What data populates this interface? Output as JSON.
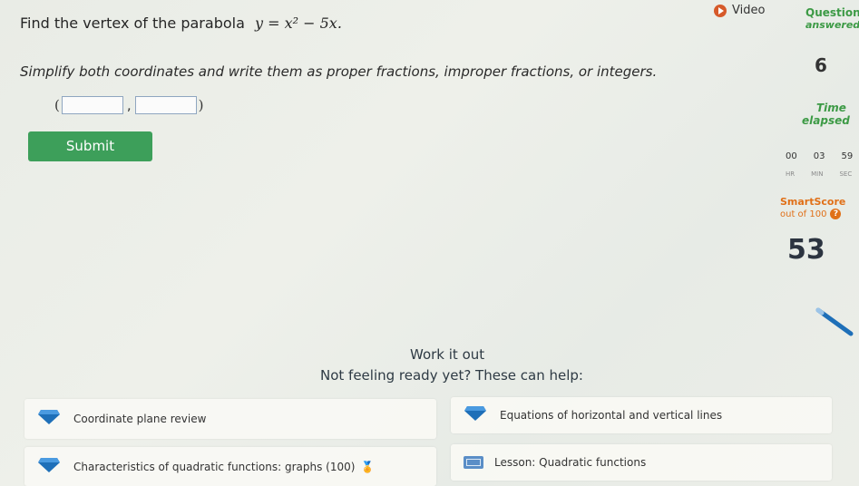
{
  "question": {
    "text": "Find the vertex of the parabola",
    "expression": "y = x² − 5x."
  },
  "instruction": "Simplify both coordinates and write them as proper fractions, improper fractions, or integers.",
  "answer": {
    "open_paren": "(",
    "comma": ",",
    "close_paren": ")",
    "x_value": "",
    "y_value": ""
  },
  "submit_label": "Submit",
  "sidebar": {
    "video_label": "Video",
    "questions_label": "Questions",
    "answered_label": "answered",
    "questions_count": "6",
    "time_label": "Time",
    "elapsed_label": "elapsed",
    "timer": {
      "hr": "00",
      "min": "03",
      "sec": "59"
    },
    "timer_units": {
      "hr": "HR",
      "min": "MIN",
      "sec": "SEC"
    },
    "smartscore_label": "SmartScore",
    "smartscore_sub": "out of 100",
    "smartscore_value": "53"
  },
  "work": {
    "title": "Work it out",
    "subtitle": "Not feeling ready yet? These can help:",
    "items": [
      {
        "label": "Coordinate plane review",
        "icon": "gem-icon"
      },
      {
        "label": "Equations of horizontal and vertical lines",
        "icon": "gem-icon"
      },
      {
        "label": "Characteristics of quadratic functions: graphs (100)",
        "icon": "gem-icon"
      },
      {
        "label": "Lesson: Quadratic functions",
        "icon": "lesson-icon"
      }
    ]
  },
  "colors": {
    "submit": "#3d9f5a",
    "green_label": "#3c9a45",
    "smartscore": "#e07018",
    "gem": "#1e6fb8"
  }
}
